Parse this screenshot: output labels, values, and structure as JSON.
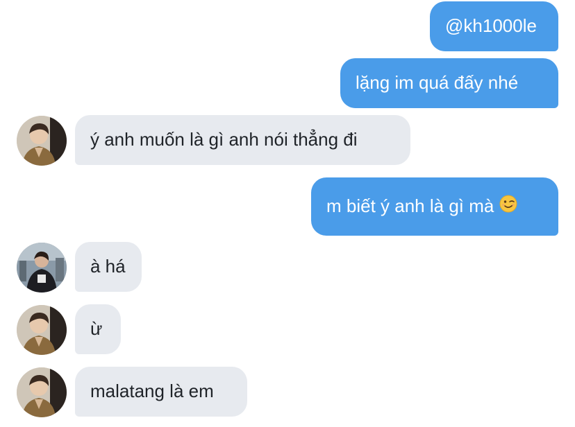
{
  "messages": [
    {
      "from": "me",
      "text": "@kh1000le"
    },
    {
      "from": "me",
      "text": "lặng im quá đấy nhé"
    },
    {
      "from": "them",
      "text": "ý anh muốn là gì anh nói thẳng đi",
      "avatar": "avatar-1"
    },
    {
      "from": "me",
      "text": "m biết ý anh là gì mà",
      "emoji": "winking-face-emoji"
    },
    {
      "from": "them",
      "text": "à há",
      "avatar": "avatar-2"
    },
    {
      "from": "them",
      "text": "ừ",
      "avatar": "avatar-1"
    },
    {
      "from": "them",
      "text": "malatang là em",
      "avatar": "avatar-1"
    }
  ],
  "colors": {
    "sent_bubble": "#4a9ce9",
    "received_bubble": "#e7eaef",
    "received_text": "#1f2328"
  }
}
